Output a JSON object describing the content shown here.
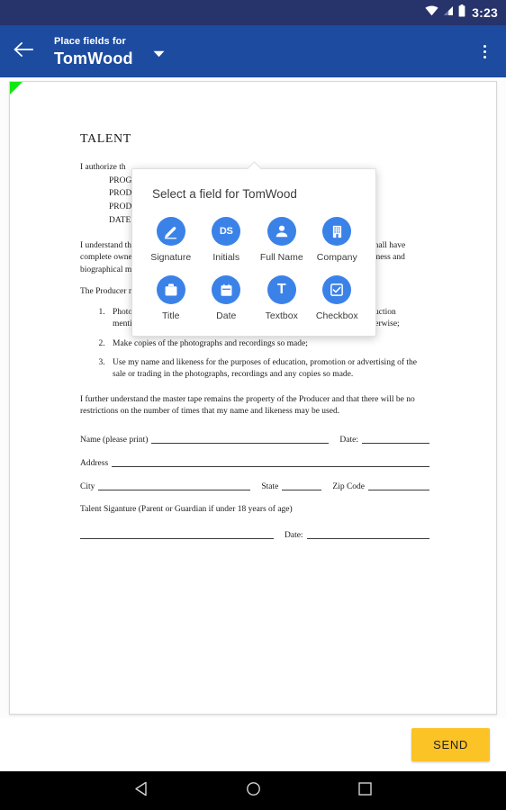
{
  "statusbar": {
    "time": "3:23",
    "icons": [
      "wifi-icon",
      "signal-icon",
      "battery-icon"
    ]
  },
  "toolbar": {
    "back_icon": "back-arrow-icon",
    "overline": "Place fields for",
    "title": "TomWood",
    "caret_icon": "chevron-down-icon",
    "overflow_icon": "overflow-menu-icon"
  },
  "popup": {
    "title": "Select a field for TomWood",
    "fields": [
      {
        "label": "Signature",
        "icon": "signature-pen-icon",
        "glyph": ""
      },
      {
        "label": "Initials",
        "icon": "initials-icon",
        "glyph": "DS"
      },
      {
        "label": "Full Name",
        "icon": "person-icon",
        "glyph": ""
      },
      {
        "label": "Company",
        "icon": "company-building-icon",
        "glyph": ""
      },
      {
        "label": "Title",
        "icon": "briefcase-icon",
        "glyph": ""
      },
      {
        "label": "Date",
        "icon": "calendar-icon",
        "glyph": ""
      },
      {
        "label": "Textbox",
        "icon": "textbox-icon",
        "glyph": "T"
      },
      {
        "label": "Checkbox",
        "icon": "checkbox-icon",
        "glyph": ""
      }
    ]
  },
  "document": {
    "title": "TALENT",
    "intro": "I authorize th",
    "header_lines": [
      "PROG",
      "PROD",
      "PROD",
      "DATE"
    ],
    "para1": "I understand that I am to receive no compensation for this appearance. The Producer shall have complete ownership of the program. I give the Producer the right to use my name, likeness and biographical material to publicize the program and the services of the Producer.",
    "para2": "The Producer may:",
    "list": [
      "Photograph me and record my voice and likeness for the purpose of the production mentioned above, whether by film, videotape, magnetic tape, digitally or otherwise;",
      "Make copies of the photographs and recordings so made;",
      "Use my name and likeness for the purposes of education, promotion or advertising of the sale or trading in the photographs, recordings and any copies so made."
    ],
    "para3": "I further understand the master tape remains the property of the Producer and that there will be no restrictions on the number of times that my name and likeness may be used.",
    "name_label": "Name (please print)",
    "date_label": "Date:",
    "address_label": "Address",
    "city_label": "City",
    "state_label": "State",
    "zip_label": "Zip Code",
    "signature_label": "Talent Siganture (Parent or Guardian if under 18 years of age)",
    "signature_date_label": "Date:"
  },
  "sendbar": {
    "send_label": "SEND"
  },
  "navbar": {
    "back_icon": "nav-back-icon",
    "home_icon": "nav-home-icon",
    "recents_icon": "nav-recents-icon"
  },
  "colors": {
    "status_bar": "#27336b",
    "toolbar": "#1c4ba0",
    "accent_blue": "#3b82e8",
    "send_yellow": "#fcc326",
    "corner_marker_green": "#12e712"
  }
}
